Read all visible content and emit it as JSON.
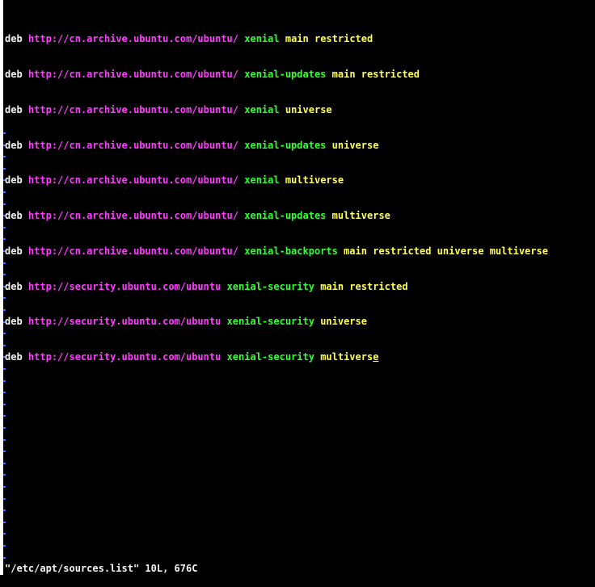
{
  "editor": {
    "lines": [
      {
        "kw": "deb",
        "url": "http://cn.archive.ubuntu.com/ubuntu/",
        "dist": "xenial",
        "comp": "main restricted"
      },
      {
        "kw": "deb",
        "url": "http://cn.archive.ubuntu.com/ubuntu/",
        "dist": "xenial-updates",
        "comp": "main restricted"
      },
      {
        "kw": "deb",
        "url": "http://cn.archive.ubuntu.com/ubuntu/",
        "dist": "xenial",
        "comp": "universe"
      },
      {
        "kw": "deb",
        "url": "http://cn.archive.ubuntu.com/ubuntu/",
        "dist": "xenial-updates",
        "comp": "universe"
      },
      {
        "kw": "deb",
        "url": "http://cn.archive.ubuntu.com/ubuntu/",
        "dist": "xenial",
        "comp": "multiverse"
      },
      {
        "kw": "deb",
        "url": "http://cn.archive.ubuntu.com/ubuntu/",
        "dist": "xenial-updates",
        "comp": "multiverse"
      },
      {
        "kw": "deb",
        "url": "http://cn.archive.ubuntu.com/ubuntu/",
        "dist": "xenial-backports",
        "comp": "main restricted universe multiverse"
      },
      {
        "kw": "deb",
        "url": "http://security.ubuntu.com/ubuntu",
        "dist": "xenial-security",
        "comp": "main restricted"
      },
      {
        "kw": "deb",
        "url": "http://security.ubuntu.com/ubuntu",
        "dist": "xenial-security",
        "comp": "universe"
      },
      {
        "kw": "deb",
        "url": "http://security.ubuntu.com/ubuntu",
        "dist": "xenial-security",
        "comp": "multivers",
        "cursor_char": "e"
      }
    ]
  },
  "status_bar": {
    "message": "\"/etc/apt/sources.list\" 10L, 676C"
  },
  "colors": {
    "background": "#000000",
    "keyword": "#f5f5f5",
    "url": "#ff3cff",
    "distribution": "#33ff33",
    "component": "#ffff55",
    "empty_line_marker": "#3b6cff"
  }
}
